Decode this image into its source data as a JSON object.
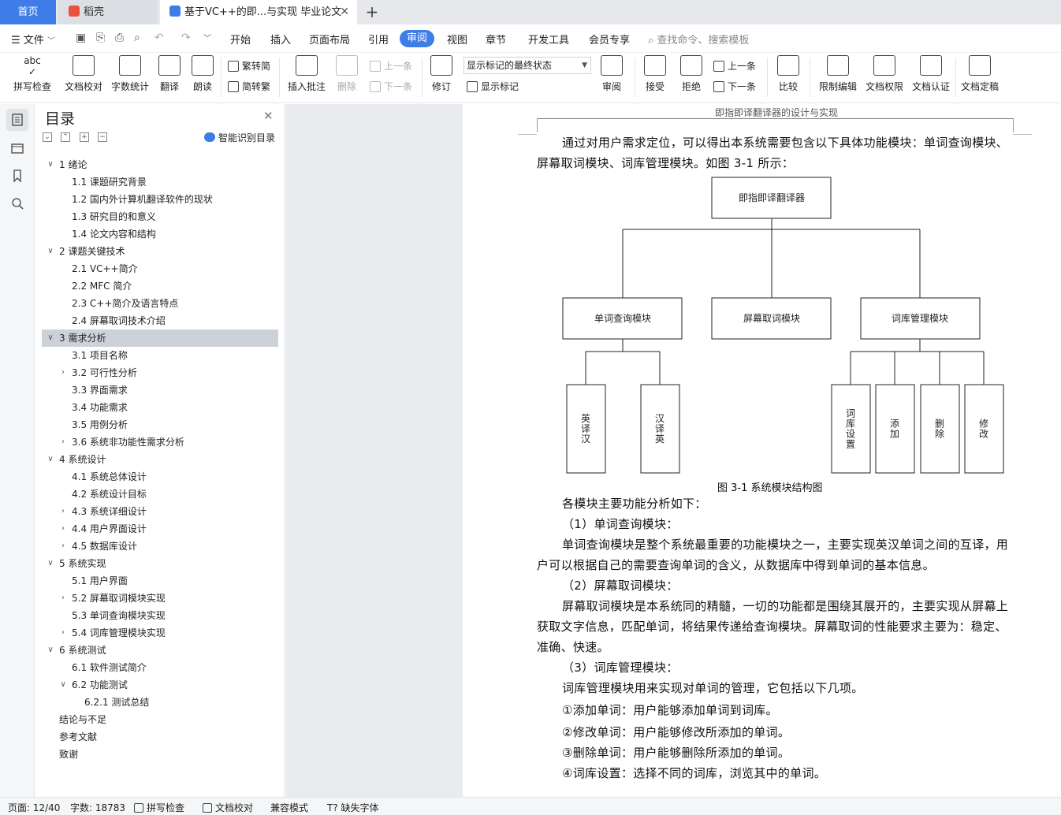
{
  "tabs": {
    "home": "首页",
    "daoke": "稻壳",
    "doc": "基于VC++的即...与实现 毕业论文"
  },
  "menu": {
    "file": "文件",
    "items": [
      "开始",
      "插入",
      "页面布局",
      "引用",
      "审阅",
      "视图",
      "章节",
      "开发工具",
      "会员专享"
    ],
    "search": "查找命令、搜索模板"
  },
  "ribbon": {
    "spell": "拼写检查",
    "doc_check": "文档校对",
    "word_count": "字数统计",
    "translate": "翻译",
    "read_aloud": "朗读",
    "trad_conv": "繁转简",
    "simp_conv": "简转繁",
    "insert_comment": "插入批注",
    "delete": "删除",
    "prev_comment": "上一条",
    "next_comment": "下一条",
    "track": "修订",
    "markup_state": "显示标记的最终状态",
    "show_markup": "显示标记",
    "review": "审阅",
    "accept": "接受",
    "reject": "拒绝",
    "prev_change": "上一条",
    "next_change": "下一条",
    "compare": "比较",
    "restrict": "限制编辑",
    "permission": "文档权限",
    "certify": "文档认证",
    "finalize": "文档定稿"
  },
  "toc": {
    "title": "目录",
    "smart": "智能识别目录",
    "items": [
      {
        "text": "1  绪论",
        "level": 1,
        "chev": "v"
      },
      {
        "text": "1.1  课题研究背景",
        "level": 2,
        "chev": ""
      },
      {
        "text": "1.2  国内外计算机翻译软件的现状",
        "level": 2,
        "chev": ""
      },
      {
        "text": "1.3  研究目的和意义",
        "level": 2,
        "chev": ""
      },
      {
        "text": "1.4  论文内容和结构",
        "level": 2,
        "chev": ""
      },
      {
        "text": "2  课题关键技术",
        "level": 1,
        "chev": "v"
      },
      {
        "text": "2.1  VC++简介",
        "level": 2,
        "chev": ""
      },
      {
        "text": "2.2  MFC 简介",
        "level": 2,
        "chev": ""
      },
      {
        "text": "2.3  C++简介及语言特点",
        "level": 2,
        "chev": ""
      },
      {
        "text": "2.4  屏幕取词技术介绍",
        "level": 2,
        "chev": ""
      },
      {
        "text": "3  需求分析",
        "level": 1,
        "chev": "v",
        "selected": true
      },
      {
        "text": "3.1  项目名称",
        "level": 2,
        "chev": ""
      },
      {
        "text": "3.2  可行性分析",
        "level": 2,
        "chev": ">"
      },
      {
        "text": "3.3  界面需求",
        "level": 2,
        "chev": ""
      },
      {
        "text": "3.4  功能需求",
        "level": 2,
        "chev": ""
      },
      {
        "text": "3.5  用例分析",
        "level": 2,
        "chev": ""
      },
      {
        "text": "3.6  系统非功能性需求分析",
        "level": 2,
        "chev": ">"
      },
      {
        "text": "4  系统设计",
        "level": 1,
        "chev": "v"
      },
      {
        "text": "4.1  系统总体设计",
        "level": 2,
        "chev": ""
      },
      {
        "text": "4.2  系统设计目标",
        "level": 2,
        "chev": ""
      },
      {
        "text": "4.3  系统详细设计",
        "level": 2,
        "chev": ">"
      },
      {
        "text": "4.4  用户界面设计",
        "level": 2,
        "chev": ">"
      },
      {
        "text": "4.5  数据库设计",
        "level": 2,
        "chev": ">"
      },
      {
        "text": "5  系统实现",
        "level": 1,
        "chev": "v"
      },
      {
        "text": "5.1  用户界面",
        "level": 2,
        "chev": ""
      },
      {
        "text": "5.2  屏幕取词模块实现",
        "level": 2,
        "chev": ">"
      },
      {
        "text": "5.3  单词查询模块实现",
        "level": 2,
        "chev": ""
      },
      {
        "text": "5.4  词库管理模块实现",
        "level": 2,
        "chev": ">"
      },
      {
        "text": "6  系统测试",
        "level": 1,
        "chev": "v"
      },
      {
        "text": "6.1  软件测试简介",
        "level": 2,
        "chev": ""
      },
      {
        "text": "6.2  功能测试",
        "level": 2,
        "chev": "v"
      },
      {
        "text": "6.2.1  测试总结",
        "level": 3,
        "chev": ""
      },
      {
        "text": "结论与不足",
        "level": 1,
        "chev": ""
      },
      {
        "text": "参考文献",
        "level": 1,
        "chev": ""
      },
      {
        "text": "致谢",
        "level": 1,
        "chev": ""
      }
    ]
  },
  "document": {
    "header": "即指即译翻译器的设计与实现",
    "intro": "通过对用户需求定位，可以得出本系统需要包含以下具体功能模块：单词查询模块、屏幕取词模块、词库管理模块。如图 3-1 所示：",
    "diagram": {
      "root": "即指即译翻译器",
      "modules": [
        "单词查询模块",
        "屏幕取词模块",
        "词库管理模块"
      ],
      "query_children": [
        "英译汉",
        "汉译英"
      ],
      "lib_children": [
        "词库设置",
        "添加",
        "删除",
        "修改"
      ]
    },
    "caption": "图 3-1  系统模块结构图",
    "p1": "各模块主要功能分析如下：",
    "h1": "（1）单词查询模块：",
    "p2": "单词查询模块是整个系统最重要的功能模块之一，主要实现英汉单词之间的互译，用户可以根据自己的需要查询单词的含义，从数据库中得到单词的基本信息。",
    "h2": "（2）屏幕取词模块：",
    "p3": "屏幕取词模块是本系统同的精髓，一切的功能都是围绕其展开的，主要实现从屏幕上获取文字信息，匹配单词，将结果传递给查询模块。屏幕取词的性能要求主要为：稳定、准确、快速。",
    "h3": "（3）词库管理模块：",
    "p4": "词库管理模块用来实现对单词的管理，它包括以下几项。",
    "l1": "①添加单词：用户能够添加单词到词库。",
    "l2": "②修改单词：用户能够修改所添加的单词。",
    "l3": "③删除单词：用户能够删除所添加的单词。",
    "l4": "④词库设置：选择不同的词库，浏览其中的单词。"
  },
  "status": {
    "page": "页面: 12/40",
    "words": "字数: 18783",
    "spell": "拼写检查",
    "doc_check": "文档校对",
    "compat": "兼容模式",
    "missing_font": "缺失字体"
  },
  "colors": {
    "accent": "#3e7ce8",
    "selection": "#cdd2d9"
  }
}
